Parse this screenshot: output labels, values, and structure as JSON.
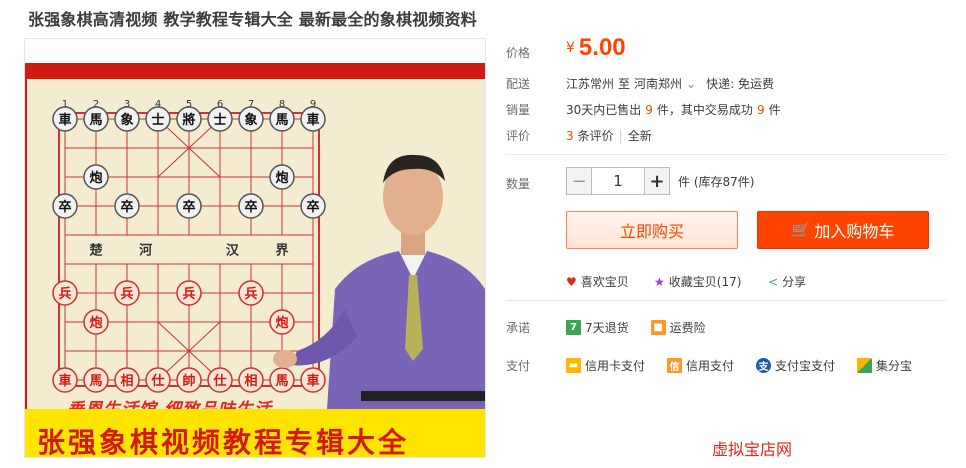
{
  "title": "张强象棋高清视频 教学教程专辑大全 最新最全的象棋视频资料",
  "image": {
    "board_top_numbers": [
      "1",
      "2",
      "3",
      "4",
      "5",
      "6",
      "7",
      "8",
      "9"
    ],
    "row1_pieces": [
      "車",
      "馬",
      "象",
      "士",
      "將",
      "士",
      "象",
      "馬",
      "車"
    ],
    "row3_pieces": [
      "炮",
      "炮"
    ],
    "row4_pieces": [
      "卒",
      "卒",
      "卒",
      "卒",
      "卒"
    ],
    "river_labels": [
      "楚",
      "河",
      "汉",
      "界"
    ],
    "row7_pieces": [
      "兵",
      "兵",
      "兵",
      "兵"
    ],
    "row8_pieces": [
      "炮",
      "炮"
    ],
    "row10_pieces": [
      "車",
      "馬",
      "相",
      "仕",
      "帥",
      "仕",
      "相",
      "馬",
      "車"
    ],
    "slogan": "垂恩生活馆 细致品味生活",
    "banner": "张强象棋视频教程专辑大全"
  },
  "price": {
    "label": "价格",
    "currency": "¥",
    "value": "5.00"
  },
  "shipping": {
    "label": "配送",
    "from": "江苏常州",
    "to_word": "至",
    "to": "河南郑州",
    "chevron": "⌄",
    "express": "快递: 免运费"
  },
  "sales": {
    "label": "销量",
    "prefix": "30天内已售出",
    "sold": "9",
    "mid": "件，其中交易成功",
    "success": "9",
    "suffix": "件"
  },
  "reviews": {
    "label": "评价",
    "count": "3",
    "text": "条评价",
    "sep": "|",
    "link": "全新"
  },
  "quantity": {
    "label": "数量",
    "minus": "−",
    "value": "1",
    "plus": "+",
    "stock": "件 (库存87件)"
  },
  "buttons": {
    "buy": "立即购买",
    "cart": "加入购物车",
    "cart_icon": "🛒"
  },
  "social": {
    "like": "喜欢宝贝",
    "favorite": "收藏宝贝(17)",
    "share": "分享"
  },
  "promise": {
    "label": "承诺",
    "return_badge": "7",
    "return": "7天退货",
    "insurance": "运费险"
  },
  "payment": {
    "label": "支付",
    "credit_card": "信用卡支付",
    "credit_badge": "信",
    "credit": "信用支付",
    "alipay_badge": "支",
    "alipay": "支付宝支付",
    "jifen": "集分宝"
  },
  "bottom_link": "虚拟宝店网",
  "colors": {
    "accent": "#ff4400",
    "price": "#ff4400",
    "board_red": "#d21a12"
  }
}
